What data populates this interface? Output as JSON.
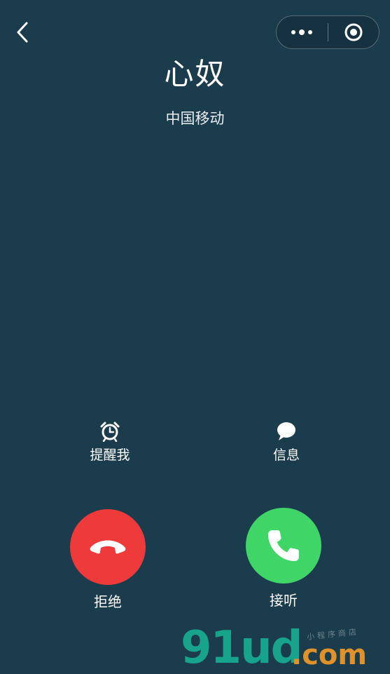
{
  "caller": {
    "name": "心奴",
    "carrier": "中国移动"
  },
  "quick_actions": {
    "remind_label": "提醒我",
    "message_label": "信息"
  },
  "call_buttons": {
    "decline_label": "拒绝",
    "accept_label": "接听"
  },
  "watermark": {
    "main": "91ud",
    "suffix": ".com",
    "small": "小程序商店"
  },
  "icons": {
    "back": "chevron-left-icon",
    "more": "more-dots-icon",
    "close": "target-circle-icon",
    "alarm": "alarm-clock-icon",
    "message": "chat-bubble-icon",
    "decline": "phone-hangup-icon",
    "accept": "phone-icon"
  },
  "colors": {
    "background": "#1b3c4d",
    "decline": "#ee3a3a",
    "accept": "#3fd667",
    "watermark_green": "#17a38c",
    "watermark_orange": "#e0912a"
  }
}
